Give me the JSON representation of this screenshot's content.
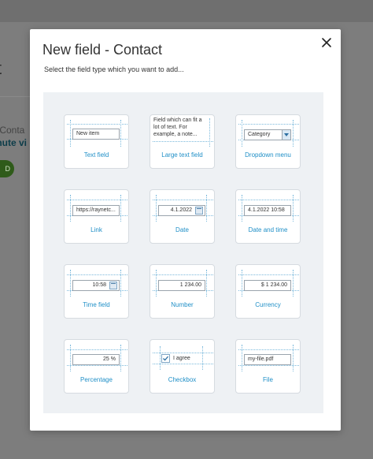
{
  "background": {
    "heading_fragment": "t",
    "line1_fragment": "r Conta",
    "line2_fragment": "inute vi",
    "button_fragment": "D"
  },
  "modal": {
    "title": "New field - Contact",
    "subtitle": "Select the field type which you want to add...",
    "close_icon": "close-icon"
  },
  "field_types": [
    {
      "id": "text-field",
      "label": "Text field",
      "preview": "New item"
    },
    {
      "id": "large-text-field",
      "label": "Large text field",
      "preview": "Field which can fit a lot of text. For example, a note..."
    },
    {
      "id": "dropdown-menu",
      "label": "Dropdown menu",
      "preview": "Category"
    },
    {
      "id": "link",
      "label": "Link",
      "preview": "https://raynetc..."
    },
    {
      "id": "date",
      "label": "Date",
      "preview": "4.1.2022"
    },
    {
      "id": "date-and-time",
      "label": "Date and time",
      "preview": "4.1.2022 10:58"
    },
    {
      "id": "time-field",
      "label": "Time field",
      "preview": "10:58"
    },
    {
      "id": "number",
      "label": "Number",
      "preview": "1 234.00"
    },
    {
      "id": "currency",
      "label": "Currency",
      "preview": "$ 1 234.00"
    },
    {
      "id": "percentage",
      "label": "Percentage",
      "preview": "25 %"
    },
    {
      "id": "checkbox",
      "label": "Checkbox",
      "preview": "I agree"
    },
    {
      "id": "file",
      "label": "File",
      "preview": "my-file.pdf"
    }
  ],
  "colors": {
    "accent": "#1f8fc7",
    "grid_bg": "#eef1f4",
    "overlay": "#777777"
  }
}
